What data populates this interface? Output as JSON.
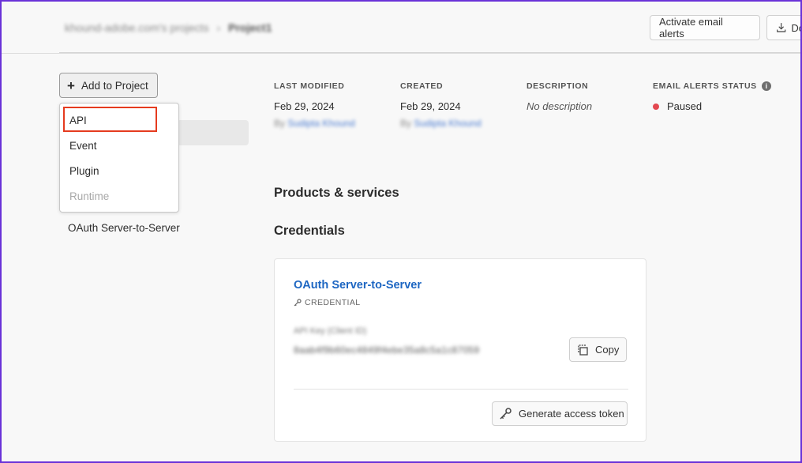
{
  "header": {
    "breadcrumb_parent": "khound-adobe.com's projects",
    "breadcrumb_separator": "›",
    "breadcrumb_current": "Project1",
    "activate_alerts_label": "Activate email alerts",
    "download_label": "Do"
  },
  "add_to_project": {
    "button_label": "Add to Project",
    "menu_items": [
      {
        "label": "API",
        "enabled": true,
        "highlighted": true
      },
      {
        "label": "Event",
        "enabled": true
      },
      {
        "label": "Plugin",
        "enabled": true
      },
      {
        "label": "Runtime",
        "enabled": false
      }
    ]
  },
  "sidebar": {
    "credential_item": "OAuth Server-to-Server"
  },
  "meta": {
    "last_modified_label": "LAST MODIFIED",
    "last_modified_value": "Feb 29, 2024",
    "last_modified_by": "Sudipta Khound",
    "created_label": "CREATED",
    "created_value": "Feb 29, 2024",
    "created_by": "Sudipta Khound",
    "by_prefix": "By",
    "description_label": "DESCRIPTION",
    "description_value": "No description",
    "email_status_label": "EMAIL ALERTS STATUS",
    "email_status_value": "Paused",
    "status_color": "#e34850"
  },
  "sections": {
    "products_title": "Products & services",
    "credentials_title": "Credentials"
  },
  "credential_card": {
    "title": "OAuth Server-to-Server",
    "subtitle": "CREDENTIAL",
    "field_label": "API Key (Client ID)",
    "field_value": "8aab4f9b60ec4849f4ebe35a8c5a1c87059",
    "copy_label": "Copy",
    "generate_token_label": "Generate access token"
  },
  "colors": {
    "accent_link": "#1d66c2",
    "highlight_border": "#e53b1f",
    "frame_border": "#6a32d8"
  }
}
